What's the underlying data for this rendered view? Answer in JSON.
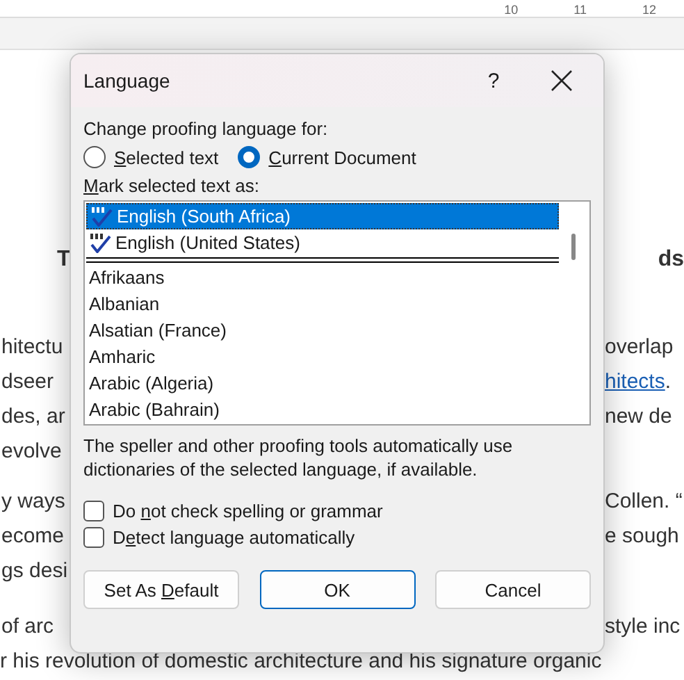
{
  "ruler": {
    "labels": [
      "10",
      "11",
      "12"
    ]
  },
  "document": {
    "paragraphs": [
      {
        "kind": "heading",
        "lines": [
          {
            "left": "T",
            "right": [
              {
                "text": "ds",
                "kind": "plain"
              }
            ]
          }
        ]
      },
      {
        "kind": "body",
        "lines": [
          {
            "left": "hitectu",
            "right": [
              {
                "text": "overlap",
                "kind": "plain"
              }
            ]
          },
          {
            "left": "dseer",
            "right": [
              {
                "text": "hitects",
                "kind": "link"
              },
              {
                "text": ".",
                "kind": "plain"
              }
            ]
          },
          {
            "left": "des, ar",
            "right": [
              {
                "text": "new de",
                "kind": "plain"
              }
            ]
          },
          {
            "left": "evolve"
          }
        ]
      },
      {
        "kind": "body",
        "lines": [
          {
            "left": "y ways",
            "right": [
              {
                "text": "Collen. “",
                "kind": "plain"
              }
            ]
          },
          {
            "left": "ecome",
            "right": [
              {
                "text": "e sough",
                "kind": "plain"
              }
            ]
          },
          {
            "left": "gs desi"
          }
        ]
      },
      {
        "kind": "body",
        "lines": [
          {
            "left": "of arc",
            "right": [
              {
                "text": "style inc",
                "kind": "plain"
              }
            ]
          },
          {
            "full": "r his revolution of domestic architecture and his signature organic"
          }
        ]
      }
    ]
  },
  "dialog": {
    "title": "Language",
    "help": "?",
    "scope_label": "Change proofing language for:",
    "scope_options": [
      {
        "access_key": "S",
        "label_after": "elected text",
        "selected": false
      },
      {
        "access_key": "C",
        "label_after": "urrent Document",
        "selected": true
      }
    ],
    "list_label": {
      "access_key": "M",
      "label_after": "ark selected text as:"
    },
    "languages": [
      {
        "name": "English (South Africa)",
        "kind": "proofing",
        "selected": true
      },
      {
        "name": "English (United States)",
        "kind": "proofing",
        "selected": false
      },
      {
        "name": "Afrikaans",
        "kind": "plain",
        "selected": false
      },
      {
        "name": "Albanian",
        "kind": "plain",
        "selected": false
      },
      {
        "name": "Alsatian (France)",
        "kind": "plain",
        "selected": false
      },
      {
        "name": "Amharic",
        "kind": "plain",
        "selected": false
      },
      {
        "name": "Arabic (Algeria)",
        "kind": "plain",
        "selected": false
      },
      {
        "name": "Arabic (Bahrain)",
        "kind": "plain",
        "selected": false
      }
    ],
    "note": "The speller and other proofing tools automatically use dictionaries of the selected language, if available.",
    "options": [
      {
        "label_before": "Do ",
        "access_key": "n",
        "label_after": "ot check spelling or grammar",
        "checked": false
      },
      {
        "label_before": "D",
        "access_key": "e",
        "label_after": "tect language automatically",
        "checked": false
      }
    ],
    "buttons": [
      {
        "label_before": "Set As ",
        "access_key": "D",
        "label_after": "efault",
        "kind": "normal"
      },
      {
        "label_after": "OK",
        "kind": "default"
      },
      {
        "label_after": "Cancel",
        "kind": "normal"
      }
    ]
  }
}
